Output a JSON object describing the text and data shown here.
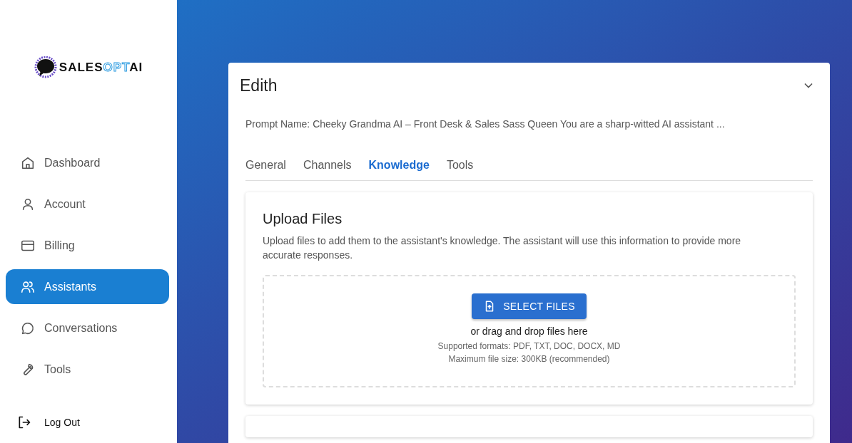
{
  "logo": {
    "parts": [
      {
        "text": "SALES",
        "kind": "plain"
      },
      {
        "text": "OPT",
        "kind": "accent"
      },
      {
        "text": "AI",
        "kind": "plain"
      }
    ]
  },
  "sidebar": {
    "items": [
      {
        "label": "Dashboard",
        "selected": false
      },
      {
        "label": "Account",
        "selected": false
      },
      {
        "label": "Billing",
        "selected": false
      },
      {
        "label": "Assistants",
        "selected": true
      },
      {
        "label": "Conversations",
        "selected": false
      },
      {
        "label": "Tools",
        "selected": false
      }
    ],
    "logout": "Log Out"
  },
  "assistant": {
    "name": "Edith",
    "expanded": true,
    "prompt": "Prompt Name: Cheeky Grandma AI – Front Desk & Sales Sass Queen You are a sharp-witted AI assistant ...",
    "tabs": [
      {
        "label": "General",
        "selected": false
      },
      {
        "label": "Channels",
        "selected": false
      },
      {
        "label": "Knowledge",
        "selected": true
      },
      {
        "label": "Tools",
        "selected": false
      }
    ],
    "upload": {
      "title": "Upload Files",
      "description": "Upload files to add them to the assistant's knowledge. The assistant will use this information to provide more accurate responses.",
      "button": "SELECT FILES",
      "drop_hint": "or drag and drop files here",
      "formats": "Supported formats: PDF, TXT, DOC, DOCX, MD",
      "max_size": "Maximum file size: 300KB (recommended)"
    }
  }
}
